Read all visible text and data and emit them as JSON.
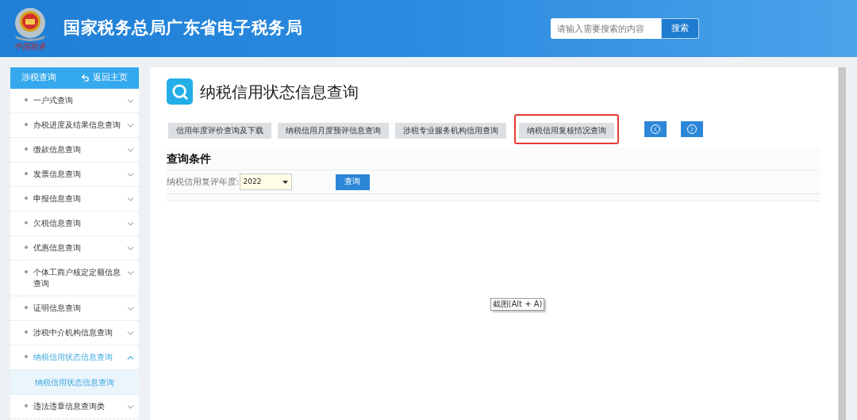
{
  "header": {
    "title": "国家税务总局广东省电子税务局",
    "logo_caption": "中国税务",
    "search": {
      "placeholder": "请输入需要搜索的内容",
      "button": "搜索"
    }
  },
  "sidebar": {
    "title": "涉税查询",
    "back_link": "返回主页",
    "items": [
      {
        "label": "一户式查询",
        "expanded": false
      },
      {
        "label": "办税进度及结果信息查询",
        "expanded": false
      },
      {
        "label": "缴款信息查询",
        "expanded": false
      },
      {
        "label": "发票信息查询",
        "expanded": false
      },
      {
        "label": "申报信息查询",
        "expanded": false
      },
      {
        "label": "欠税信息查询",
        "expanded": false
      },
      {
        "label": "优惠信息查询",
        "expanded": false
      },
      {
        "label": "个体工商户核定定额信息查询",
        "expanded": false
      },
      {
        "label": "证明信息查询",
        "expanded": false
      },
      {
        "label": "涉税中介机构信息查询",
        "expanded": false
      },
      {
        "label": "纳税信用状态信息查询",
        "expanded": true,
        "children": [
          {
            "label": "纳税信用状态信息查询",
            "selected": true
          }
        ]
      },
      {
        "label": "违法违章信息查询类",
        "expanded": false
      }
    ]
  },
  "main": {
    "title": "纳税信用状态信息查询",
    "tabs": [
      {
        "label": "信用年度评价查询及下载",
        "highlighted": false
      },
      {
        "label": "纳税信用月度预评信息查询",
        "highlighted": false
      },
      {
        "label": "涉税专业服务机构信用查询",
        "highlighted": false
      },
      {
        "label": "纳税信用复核情况查询",
        "highlighted": true
      }
    ],
    "section_title": "查询条件",
    "form": {
      "label": "纳税信用复评年度:",
      "year": "2022",
      "button": "查询"
    },
    "tooltip": "截图(Alt + A)"
  }
}
